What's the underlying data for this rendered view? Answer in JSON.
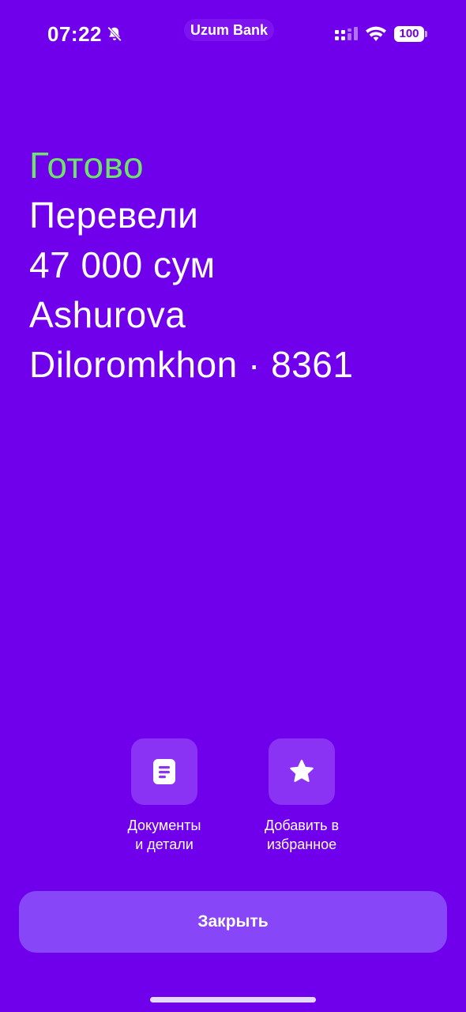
{
  "status_bar": {
    "time": "07:22",
    "app_name": "Uzum Bank",
    "battery": "100",
    "icons": [
      "bell-muted-icon",
      "signal-icon",
      "wifi-icon",
      "battery-icon"
    ]
  },
  "result": {
    "status": "Готово",
    "lines": [
      "Перевели",
      "47 000 сум",
      "Ashurova",
      "Diloromkhon · 8361"
    ]
  },
  "actions": [
    {
      "label": "Документы\nи детали",
      "icon": "document-icon"
    },
    {
      "label": "Добавить в\nизбранное",
      "icon": "star-icon"
    }
  ],
  "close_label": "Закрыть",
  "colors": {
    "background": "#7000EB",
    "status_green": "#6EE26B",
    "tile": "#8A33F5",
    "button": "#8747F9"
  }
}
